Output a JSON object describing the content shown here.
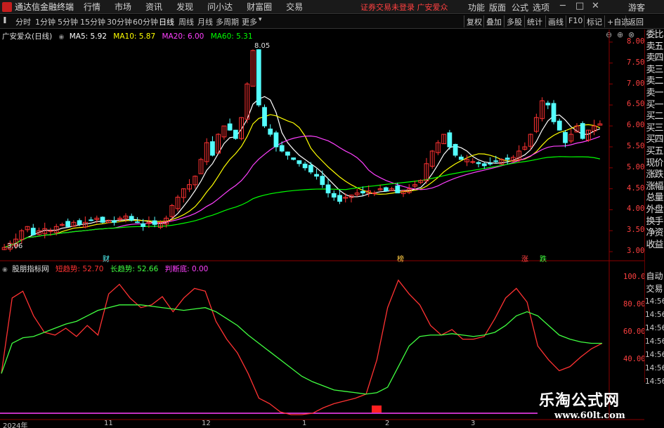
{
  "menubar": {
    "app_title": "通达信金融终端",
    "menus": [
      "行情",
      "市场",
      "资讯",
      "发现",
      "问小达",
      "财富圈",
      "交易"
    ],
    "status": "证券交易未登录 广安爱众",
    "right_menus": [
      "功能",
      "版面",
      "公式",
      "选项"
    ],
    "guest": "游客"
  },
  "toolbar": {
    "periods": [
      "分时",
      "1分钟",
      "5分钟",
      "15分钟",
      "30分钟",
      "60分钟",
      "日线",
      "周线",
      "月线",
      "多周期",
      "更多"
    ],
    "active_period": "日线",
    "right_buttons": [
      "复权",
      "叠加",
      "多股",
      "统计",
      "画线",
      "F10",
      "标记",
      "+自选",
      "返回"
    ]
  },
  "main_legend": {
    "stock": "广安爱众(日线)",
    "ma5": "MA5: 5.92",
    "ma10": "MA10: 5.87",
    "ma20": "MA20: 6.00",
    "ma60": "MA60: 5.31"
  },
  "indicator_legend": {
    "name": "股朋指标网",
    "short": "短趋势: 52.70",
    "long": "长趋势: 52.66",
    "judge": "判断底: 0.00"
  },
  "price_axis": [
    "8.00",
    "7.50",
    "7.00",
    "6.50",
    "6.00",
    "5.50",
    "5.00",
    "4.50",
    "4.00",
    "3.50",
    "3.00"
  ],
  "indicator_axis": [
    "100.0",
    "80.00",
    "60.00",
    "40.00"
  ],
  "annotations": {
    "high": "8.05",
    "low": "3.06",
    "markers": [
      "财",
      "榜",
      "涨",
      "跌"
    ]
  },
  "side_panel": [
    "委比",
    "卖五",
    "卖四",
    "卖三",
    "卖二",
    "卖一",
    "买一",
    "买二",
    "买三",
    "买四",
    "买五",
    "现价",
    "涨跌",
    "涨幅",
    "总量",
    "外盘",
    "换手",
    "净资",
    "收益"
  ],
  "side_panel2": {
    "labels": [
      "自动",
      "交易"
    ],
    "times": [
      "14:56",
      "14:56",
      "14:56",
      "14:56",
      "14:56",
      "14:56",
      "14:56"
    ]
  },
  "date_axis": [
    "2024年",
    "11",
    "12",
    "1",
    "2",
    "3"
  ],
  "watermark": {
    "title": "乐淘公式网",
    "url": "www.60lt.com"
  },
  "colors": {
    "up": "#ff3232",
    "down": "#54ffff",
    "ma5": "#ffffff",
    "ma10": "#ffff00",
    "ma20": "#ff40ff",
    "ma60": "#00ff00",
    "short_trend": "#ff3232",
    "long_trend": "#40ff40",
    "judge": "#ff40ff",
    "axis_text": "#ff4040"
  },
  "chart_data": {
    "type": "candlestick",
    "price_range": [
      2.8,
      8.3
    ],
    "closes": [
      3.1,
      3.2,
      3.3,
      3.5,
      3.6,
      3.4,
      3.5,
      3.55,
      3.5,
      3.6,
      3.65,
      3.6,
      3.7,
      3.65,
      3.7,
      3.75,
      3.8,
      3.7,
      3.75,
      3.7,
      3.8,
      3.85,
      3.75,
      3.7,
      3.6,
      3.7,
      3.65,
      3.7,
      3.8,
      4.1,
      4.3,
      4.5,
      4.6,
      4.8,
      5.2,
      5.6,
      5.3,
      5.8,
      6.0,
      5.9,
      5.7,
      6.2,
      7.0,
      7.8,
      6.5,
      6.0,
      5.8,
      5.5,
      5.4,
      5.3,
      5.2,
      5.1,
      5.0,
      4.9,
      4.8,
      4.6,
      4.4,
      4.3,
      4.2,
      4.3,
      4.35,
      4.4,
      4.4,
      4.45,
      4.4,
      4.5,
      4.45,
      4.5,
      4.4,
      4.45,
      4.5,
      4.6,
      4.7,
      5.1,
      5.4,
      5.6,
      5.8,
      5.5,
      5.3,
      5.2,
      5.2,
      5.15,
      5.1,
      5.05,
      5.1,
      5.15,
      5.2,
      5.2,
      5.25,
      5.4,
      5.5,
      5.8,
      6.2,
      6.6,
      6.5,
      6.1,
      5.9,
      5.6,
      5.8,
      6.0,
      5.7,
      5.9,
      6.0,
      6.05
    ],
    "series": [
      {
        "name": "短趋势",
        "values": [
          30,
          85,
          90,
          72,
          60,
          58,
          63,
          57,
          65,
          58,
          88,
          95,
          85,
          78,
          80,
          86,
          75,
          85,
          92,
          90,
          68,
          55,
          45,
          30,
          12,
          8,
          2,
          0,
          0,
          1,
          5,
          8,
          10,
          12,
          15,
          40,
          78,
          98,
          88,
          80,
          65,
          58,
          62,
          55,
          55,
          57,
          70,
          85,
          92,
          82,
          50,
          40,
          32,
          35,
          42,
          48,
          52
        ]
      },
      {
        "name": "长趋势",
        "values": [
          30,
          52,
          56,
          57,
          60,
          63,
          66,
          68,
          72,
          76,
          78,
          80,
          80,
          80,
          79,
          78,
          77,
          76,
          77,
          78,
          75,
          70,
          65,
          58,
          52,
          46,
          40,
          34,
          28,
          24,
          21,
          18,
          17,
          16,
          15,
          16,
          20,
          35,
          50,
          57,
          58,
          58,
          59,
          58,
          57,
          58,
          60,
          65,
          72,
          75,
          72,
          65,
          58,
          55,
          53,
          52,
          52
        ]
      }
    ]
  }
}
